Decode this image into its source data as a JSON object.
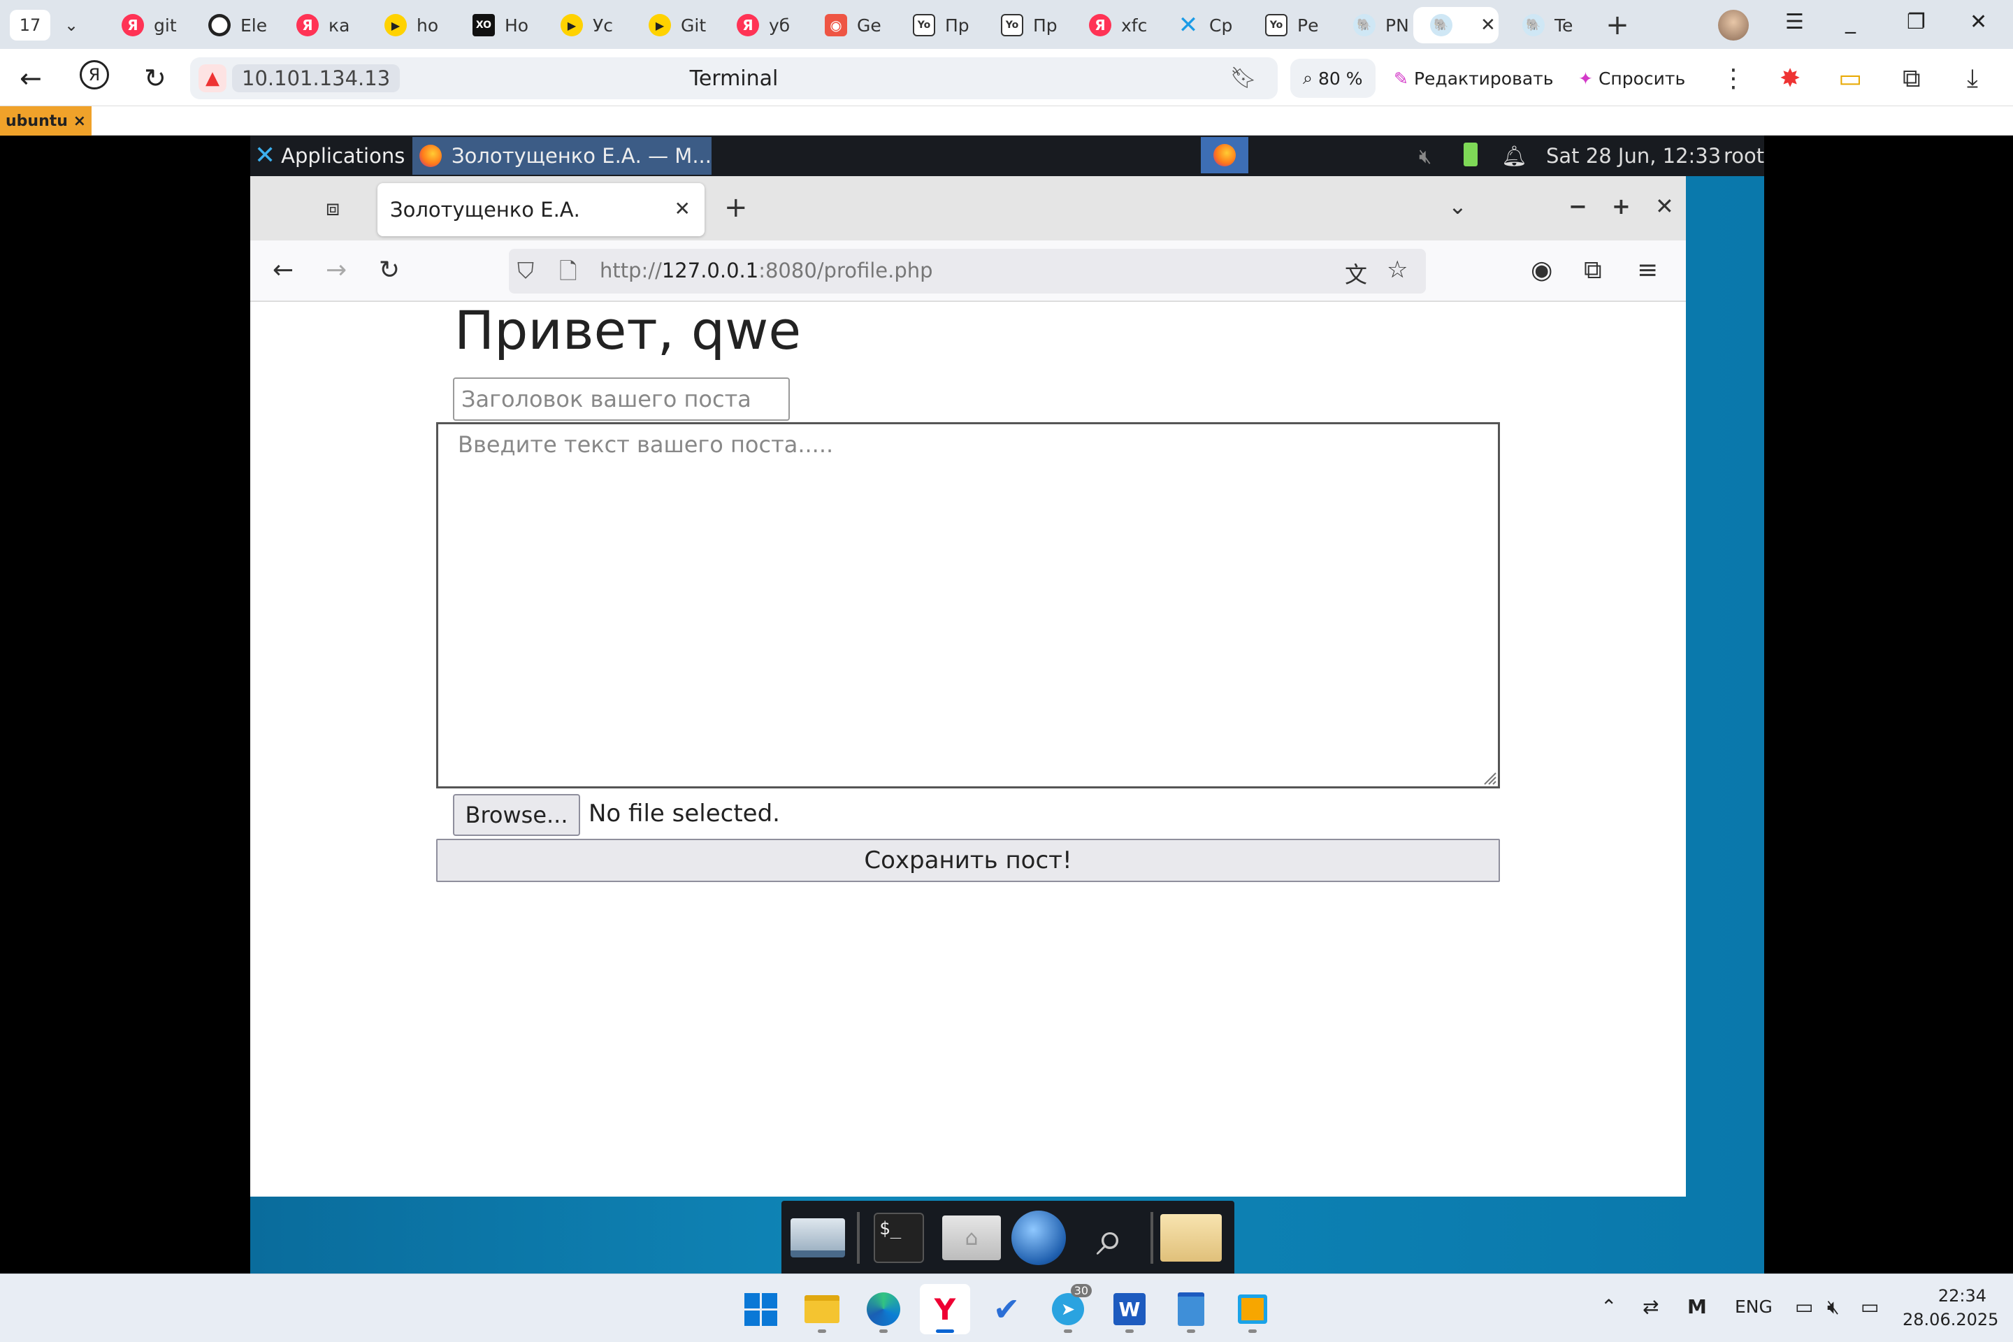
{
  "yandex": {
    "tab_count": "17",
    "tabs": [
      {
        "label": "git",
        "fav": "Я"
      },
      {
        "label": "Ele",
        "fav": ""
      },
      {
        "label": "ка",
        "fav": "Я"
      },
      {
        "label": "ho",
        "fav": "▶"
      },
      {
        "label": "Но",
        "fav": "XO"
      },
      {
        "label": "Ус",
        "fav": "▶"
      },
      {
        "label": "Git",
        "fav": "▶"
      },
      {
        "label": "уб",
        "fav": "Я"
      },
      {
        "label": "Ge",
        "fav": "◉"
      },
      {
        "label": "Пр",
        "fav": "Yo"
      },
      {
        "label": "Пр",
        "fav": "Yo"
      },
      {
        "label": "xfc",
        "fav": "Я"
      },
      {
        "label": "Ср",
        "fav": "✕"
      },
      {
        "label": "Ре",
        "fav": "Yo"
      },
      {
        "label": "PN",
        "fav": "🐘"
      },
      {
        "label": "",
        "fav": "🐘"
      },
      {
        "label": "Te",
        "fav": "🐘"
      }
    ],
    "address_host": "10.101.134.13",
    "page_title": "Terminal",
    "zoom": "80 %",
    "edit_label": "Редактировать",
    "ask_label": "Спросить",
    "infobar_tag": "ubuntu ×"
  },
  "xfce": {
    "applications_label": "Applications",
    "task_label": "Золотущенко Е.А. — М...",
    "datetime": "Sat 28 Jun, 12:33",
    "user": "root"
  },
  "firefox": {
    "tab_title": "Золотущенко Е.А.",
    "url_scheme_host": "http://",
    "url_host": "127.0.0.1",
    "url_path": ":8080/profile.php"
  },
  "page": {
    "greeting": "Привет, qwe",
    "title_placeholder": "Заголовок вашего поста",
    "body_placeholder": "Введите текст вашего поста.....",
    "browse_label": "Browse...",
    "no_file_label": "No file selected.",
    "save_label": "Сохранить пост!"
  },
  "taskbar": {
    "lang": "ENG",
    "time": "22:34",
    "date": "28.06.2025",
    "telegram_badge": "30"
  }
}
